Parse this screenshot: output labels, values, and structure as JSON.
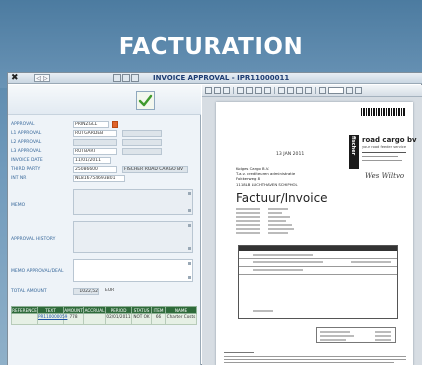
{
  "banner": {
    "title": "FACTURATION"
  },
  "window": {
    "close_label": "✖",
    "nav_label": "◁ ▷",
    "title": "INVOICE APPROVAL - IPR11000011"
  },
  "form": {
    "fields": [
      {
        "label": "APPROVAL",
        "value": "PRINZGLL"
      },
      {
        "label": "L1 APPROVAL",
        "value": "RUTGARDEB"
      },
      {
        "label": "L2 APPROVAL",
        "value": ""
      },
      {
        "label": "L3 APPROVAL",
        "value": "RUTBART"
      },
      {
        "label": "INVOICE DATE",
        "value": "11/01/2011"
      },
      {
        "label": "THIRD PARTY",
        "value": "25086600",
        "extra": "FISCHER ROAD CARGO BV"
      },
      {
        "label": "INT NR",
        "value": "NL816754693B01"
      },
      {
        "label": "MEMO",
        "value": ""
      },
      {
        "label": "APPROVAL HISTORY",
        "value": ""
      },
      {
        "label": "MEMO APPROVAL/DEAL",
        "value": ""
      },
      {
        "label": "TOTAL AMOUNT",
        "value": "1022,52",
        "currency": "EUR"
      }
    ],
    "table": {
      "headers": [
        "REFERENCE",
        "TEXT",
        "AMOUNT",
        "ACCRUAL",
        "PERIOD",
        "STATUS",
        "ITEM",
        "NAME"
      ],
      "rows": [
        {
          "reference": "",
          "text": "PR110000059",
          "amount": "778",
          "accrual": "",
          "period": "02/01/2011",
          "status": "NOT OK",
          "item": "66",
          "name": "Charter Costs"
        }
      ]
    }
  },
  "document": {
    "brand_line1": "road cargo bv",
    "brand_line2": "your road feeder service",
    "brand_vertical": "fischer",
    "stamp_date": "13 JAN 2011",
    "address_1": "Kolges Cargo B.V.",
    "address_2": "T.a.v. crediteuren administratie",
    "address_3": "Fokkerweg 8",
    "address_4": "1118LB LUCHTHAVEN SCHIPHOL",
    "invoice_title": "Factuur/Invoice",
    "signature": "Wes Wiltvo"
  }
}
